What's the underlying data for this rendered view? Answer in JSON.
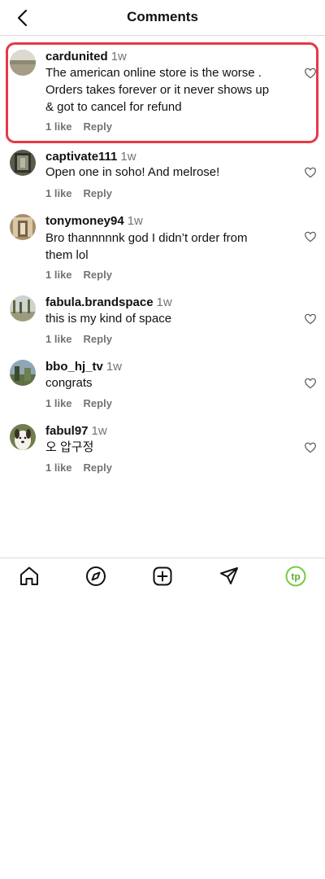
{
  "header": {
    "title": "Comments",
    "back_icon": "chevron-left-icon"
  },
  "comments": [
    {
      "username": "cardunited",
      "time": "1w",
      "text": [
        "The american online store is the worse .",
        "Orders takes forever or it never shows up",
        "& got to cancel for refund"
      ],
      "likes": "1 like",
      "reply": "Reply",
      "highlighted": true
    },
    {
      "username": "captivate111",
      "time": "1w",
      "text": [
        "Open one in soho! And melrose!"
      ],
      "likes": "1 like",
      "reply": "Reply"
    },
    {
      "username": "tonymoney94",
      "time": "1w",
      "text": [
        "Bro thannnnnk god I didn’t order from",
        "them lol"
      ],
      "likes": "1 like",
      "reply": "Reply"
    },
    {
      "username": "fabula.brandspace",
      "time": "1w",
      "text": [
        "this is my kind of space"
      ],
      "likes": "1 like",
      "reply": "Reply"
    },
    {
      "username": "bbo_hj_tv",
      "time": "1w",
      "text": [
        "congrats⁦⁦⁦"
      ],
      "likes": "1 like",
      "reply": "Reply"
    },
    {
      "username": "fabul97",
      "time": "1w",
      "text": [
        "오 압구정"
      ],
      "likes": "1 like",
      "reply": "Reply"
    }
  ],
  "tabbar": [
    "home-icon",
    "explore-icon",
    "new-post-icon",
    "direct-message-icon",
    "profile-icon"
  ],
  "colors": {
    "highlight_border": "#e53947",
    "muted": "#737373",
    "divider": "#dbdbdb",
    "profile_accent": "#7ac943"
  }
}
